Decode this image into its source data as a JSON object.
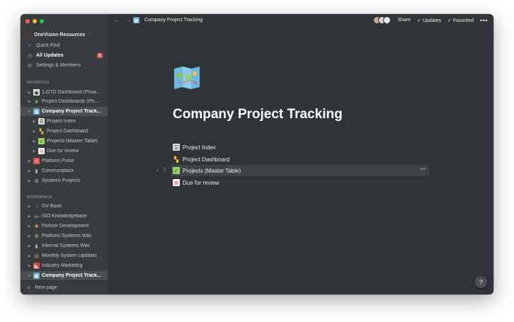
{
  "workspace": {
    "name": "OneVision Resources"
  },
  "sidebar": {
    "quick_find": "Quick Find",
    "all_updates": "All Updates",
    "updates_badge": "5",
    "settings": "Settings & Members",
    "favorites_label": "FAVORITES",
    "workspace_label": "WORKSPACE",
    "favorites": [
      {
        "label": "1.GTD Dashboard (Priva...",
        "icon": "gtd-icon",
        "level": 0,
        "expanded": false
      },
      {
        "label": "Project Dashboards (Pri...",
        "icon": "plant-icon",
        "level": 0,
        "expanded": false
      },
      {
        "label": "Company Project Track...",
        "icon": "map-icon",
        "level": 0,
        "expanded": true,
        "active": true
      },
      {
        "label": "Project Index",
        "icon": "table-icon",
        "level": 1,
        "expanded": false
      },
      {
        "label": "Project Dashboard",
        "icon": "grid-icon",
        "level": 1,
        "expanded": false
      },
      {
        "label": "Projects (Master Table)",
        "icon": "folder-check-icon",
        "level": 1,
        "expanded": false
      },
      {
        "label": "Due for review",
        "icon": "calendar-icon",
        "level": 1,
        "expanded": false
      },
      {
        "label": "Platform Pulse",
        "icon": "pulse-icon",
        "level": 0,
        "expanded": false
      },
      {
        "label": "Commonplace",
        "icon": "book-icon",
        "level": 0,
        "expanded": false
      },
      {
        "label": "Systems Projects",
        "icon": "gear-icon",
        "level": 0,
        "expanded": false
      }
    ],
    "workspace_items": [
      {
        "label": "OV Base",
        "icon": "house-icon"
      },
      {
        "label": "ISO Knowledgebase",
        "icon": "book-open-icon"
      },
      {
        "label": "Partner Development",
        "icon": "puzzle-icon"
      },
      {
        "label": "Platform Systems Wiki",
        "icon": "gear-icon"
      },
      {
        "label": "Internal Systems Wiki",
        "icon": "book-icon"
      },
      {
        "label": "Monthly System Updates",
        "icon": "newspaper-icon"
      },
      {
        "label": "Industry Marketing",
        "icon": "megaphone-icon"
      },
      {
        "label": "Company Project Track...",
        "icon": "map-icon",
        "active": true
      }
    ],
    "new_page": "New page"
  },
  "topbar": {
    "breadcrumb": "Company Project Tracking",
    "share": "Share",
    "updates": "Updates",
    "favorited": "Favorited"
  },
  "page": {
    "icon": "map-icon",
    "title": "Company Project Tracking",
    "links": [
      {
        "label": "Project Index",
        "icon": "table-icon"
      },
      {
        "label": "Project Dashboard",
        "icon": "grid-icon"
      },
      {
        "label": "Projects (Master Table)",
        "icon": "folder-check-icon",
        "hover": true
      },
      {
        "label": "Due for review",
        "icon": "calendar-icon"
      }
    ]
  },
  "help_label": "?",
  "colors": {
    "background": "#2f3437",
    "sidebar": "#373c3f",
    "badge": "#e25a4f"
  }
}
